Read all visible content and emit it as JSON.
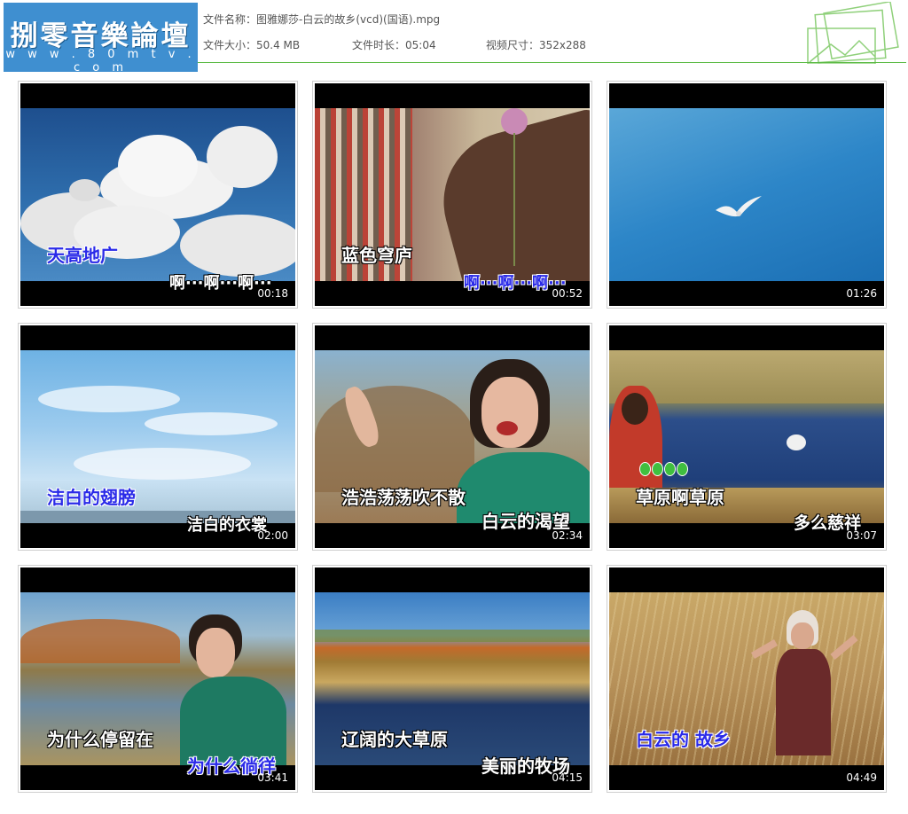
{
  "header": {
    "logo_title": "捌零音樂論壇",
    "logo_url": "w w w . 8 0 m t v . c o m",
    "file_name_label": "文件名称：",
    "file_name": "图雅娜莎-白云的故乡(vcd)(国语).mpg",
    "file_size_label": "文件大小：",
    "file_size": "50.4 MB",
    "duration_label": "文件时长：",
    "duration": "05:04",
    "resolution_label": "视频尺寸：",
    "resolution": "352x288",
    "accent_color": "#5dbb46",
    "logo_color": "#3f8fd0"
  },
  "thumbnails": [
    {
      "lyrics": [
        "天高地广",
        "啊···啊···啊···"
      ],
      "timestamp": "00:18"
    },
    {
      "lyrics": [
        "蓝色穹庐",
        "啊···啊···啊···"
      ],
      "timestamp": "00:52"
    },
    {
      "lyrics": [],
      "timestamp": "01:26"
    },
    {
      "lyrics": [
        "洁白的翅膀",
        "洁白的衣裳"
      ],
      "timestamp": "02:00"
    },
    {
      "lyrics": [
        "浩浩荡荡吹不散",
        "白云的渴望"
      ],
      "timestamp": "02:34"
    },
    {
      "lyrics": [
        "草原啊草原",
        "多么慈祥"
      ],
      "timestamp": "03:07"
    },
    {
      "lyrics": [
        "为什么停留在",
        "为什么徜徉"
      ],
      "timestamp": "03:41"
    },
    {
      "lyrics": [
        "辽阔的大草原",
        "美丽的牧场"
      ],
      "timestamp": "04:15"
    },
    {
      "lyrics": [
        "白云的 故乡"
      ],
      "timestamp": "04:49"
    }
  ]
}
